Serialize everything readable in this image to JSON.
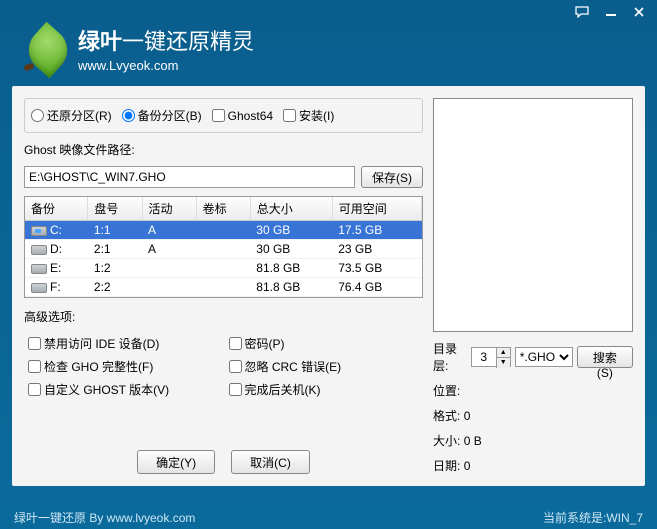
{
  "app": {
    "title_main": "绿叶",
    "title_sub": "一键还原精灵",
    "url": "www.Lvyeok.com"
  },
  "modes": {
    "restore": "还原分区(R)",
    "backup": "备份分区(B)",
    "ghost64": "Ghost64",
    "install": "安装(I)",
    "selected": "backup"
  },
  "path": {
    "label": "Ghost 映像文件路径:",
    "value": "E:\\GHOST\\C_WIN7.GHO",
    "save_btn": "保存(S)"
  },
  "table": {
    "headers": [
      "备份",
      "盘号",
      "活动",
      "卷标",
      "总大小",
      "可用空间"
    ],
    "rows": [
      {
        "drive": "C:",
        "sys": true,
        "disk": "1:1",
        "active": "A",
        "label": "",
        "total": "30 GB",
        "free": "17.5 GB",
        "selected": true
      },
      {
        "drive": "D:",
        "sys": false,
        "disk": "2:1",
        "active": "A",
        "label": "",
        "total": "30 GB",
        "free": "23 GB",
        "selected": false
      },
      {
        "drive": "E:",
        "sys": false,
        "disk": "1:2",
        "active": "",
        "label": "",
        "total": "81.8 GB",
        "free": "73.5 GB",
        "selected": false
      },
      {
        "drive": "F:",
        "sys": false,
        "disk": "2:2",
        "active": "",
        "label": "",
        "total": "81.8 GB",
        "free": "76.4 GB",
        "selected": false
      }
    ]
  },
  "adv": {
    "label": "高级选项:",
    "disable_ide": "禁用访问 IDE 设备(D)",
    "password": "密码(P)",
    "check_gho": "检查 GHO 完整性(F)",
    "ignore_crc": "忽略 CRC 错误(E)",
    "custom_ghost": "自定义 GHOST 版本(V)",
    "shutdown": "完成后关机(K)"
  },
  "right": {
    "dir_level_label": "目录层:",
    "dir_level_value": "3",
    "filter_selected": "*.GHO",
    "search_btn": "搜索(S)",
    "pos_label": "位置:",
    "fmt_label": "格式:",
    "fmt_value": "0",
    "size_label": "大小:",
    "size_value": "0 B",
    "date_label": "日期:",
    "date_value": "0"
  },
  "buttons": {
    "ok": "确定(Y)",
    "cancel": "取消(C)"
  },
  "status": {
    "left": "绿叶一键还原 By www.lvyeok.com",
    "right": "当前系统是:WIN_7"
  }
}
